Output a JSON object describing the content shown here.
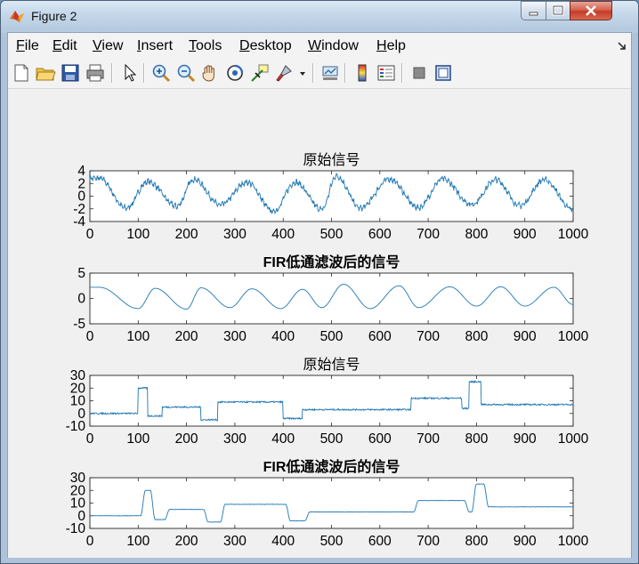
{
  "window": {
    "title": "Figure 2"
  },
  "menu": [
    {
      "pre": "",
      "u": "F",
      "post": "ile"
    },
    {
      "pre": "",
      "u": "E",
      "post": "dit"
    },
    {
      "pre": "",
      "u": "V",
      "post": "iew"
    },
    {
      "pre": "",
      "u": "I",
      "post": "nsert"
    },
    {
      "pre": "",
      "u": "T",
      "post": "ools"
    },
    {
      "pre": "",
      "u": "D",
      "post": "esktop"
    },
    {
      "pre": "",
      "u": "W",
      "post": "indow"
    },
    {
      "pre": "",
      "u": "H",
      "post": "elp"
    }
  ],
  "toolbar": {
    "icons": [
      "new-figure-icon",
      "open-file-icon",
      "save-icon",
      "print-icon",
      "pointer-icon",
      "zoom-in-icon",
      "zoom-out-icon",
      "pan-hand-icon",
      "rotate-3d-icon",
      "data-cursor-icon",
      "brush-icon",
      "brush-dropdown-icon",
      "link-plot-icon",
      "colorbar-icon",
      "legend-icon",
      "hide-plot-tools-icon",
      "show-plot-tools-icon"
    ]
  },
  "colors": {
    "line": "#1f77b4",
    "axes_bg": "#ffffff",
    "figure_bg": "#f0f0f0"
  },
  "chart_data": [
    {
      "type": "line",
      "title": "原始信号",
      "title_bold": false,
      "xlim": [
        0,
        1000
      ],
      "ylim": [
        -4,
        4
      ],
      "xticks": [
        "0",
        "100",
        "200",
        "300",
        "400",
        "500",
        "600",
        "700",
        "800",
        "900",
        "1000"
      ],
      "yticks": [
        "4",
        "2",
        "0",
        "-2",
        "-4"
      ],
      "signal": {
        "kind": "noisy_periodic",
        "period": 55,
        "peaks": [
          [
            20,
            2.8
          ],
          [
            75,
            -1.9
          ],
          [
            120,
            2.3
          ],
          [
            180,
            -1.6
          ],
          [
            215,
            2.7
          ],
          [
            270,
            -1.4
          ],
          [
            325,
            2.2
          ],
          [
            380,
            -2.4
          ],
          [
            425,
            2.2
          ],
          [
            480,
            -2.1
          ],
          [
            510,
            3.2
          ],
          [
            560,
            -1.9
          ],
          [
            620,
            2.7
          ],
          [
            680,
            -1.8
          ],
          [
            730,
            2.7
          ],
          [
            790,
            -1.3
          ],
          [
            840,
            2.6
          ],
          [
            890,
            -1.5
          ],
          [
            940,
            2.6
          ],
          [
            1000,
            -2.2
          ]
        ],
        "noise": 0.35
      }
    },
    {
      "type": "line",
      "title": "FIR低通滤波后的信号",
      "title_bold": true,
      "xlim": [
        0,
        1000
      ],
      "ylim": [
        -5,
        5
      ],
      "xticks": [
        "0",
        "100",
        "200",
        "300",
        "400",
        "500",
        "600",
        "700",
        "800",
        "900",
        "1000"
      ],
      "yticks": [
        "5",
        "0",
        "-5"
      ],
      "signal": {
        "kind": "smooth_periodic",
        "peaks": [
          [
            20,
            2.2
          ],
          [
            100,
            -2.0
          ],
          [
            135,
            2.0
          ],
          [
            200,
            -2.1
          ],
          [
            230,
            2.1
          ],
          [
            290,
            -1.8
          ],
          [
            335,
            1.9
          ],
          [
            395,
            -2.0
          ],
          [
            440,
            1.8
          ],
          [
            480,
            -1.8
          ],
          [
            525,
            2.8
          ],
          [
            580,
            -2.0
          ],
          [
            640,
            2.5
          ],
          [
            680,
            -1.8
          ],
          [
            745,
            2.3
          ],
          [
            800,
            -1.5
          ],
          [
            850,
            2.3
          ],
          [
            900,
            -1.5
          ],
          [
            960,
            2.2
          ],
          [
            1000,
            -1.2
          ]
        ],
        "noise": 0.0
      }
    },
    {
      "type": "line",
      "title": "原始信号",
      "title_bold": false,
      "xlim": [
        0,
        1000
      ],
      "ylim": [
        -10,
        30
      ],
      "xticks": [
        "0",
        "100",
        "200",
        "300",
        "400",
        "500",
        "600",
        "700",
        "800",
        "900",
        "1000"
      ],
      "yticks": [
        "30",
        "20",
        "10",
        "0",
        "-10"
      ],
      "signal": {
        "kind": "step",
        "steps": [
          [
            0,
            0
          ],
          [
            100,
            20
          ],
          [
            120,
            -2
          ],
          [
            150,
            5
          ],
          [
            230,
            -5
          ],
          [
            265,
            9
          ],
          [
            400,
            -4
          ],
          [
            440,
            3
          ],
          [
            665,
            12
          ],
          [
            770,
            4
          ],
          [
            785,
            25
          ],
          [
            810,
            7
          ],
          [
            1000,
            7
          ]
        ],
        "noise": 0.6
      }
    },
    {
      "type": "line",
      "title": "FIR低通滤波后的信号",
      "title_bold": true,
      "xlim": [
        0,
        1000
      ],
      "ylim": [
        -10,
        30
      ],
      "xticks": [
        "0",
        "100",
        "200",
        "300",
        "400",
        "500",
        "600",
        "700",
        "800",
        "900",
        "1000"
      ],
      "yticks": [
        "30",
        "20",
        "10",
        "0",
        "-10"
      ],
      "signal": {
        "kind": "step",
        "steps": [
          [
            0,
            0
          ],
          [
            110,
            20
          ],
          [
            130,
            -3
          ],
          [
            160,
            5
          ],
          [
            240,
            -5
          ],
          [
            275,
            9
          ],
          [
            410,
            -4
          ],
          [
            450,
            3
          ],
          [
            675,
            12
          ],
          [
            780,
            3
          ],
          [
            795,
            25
          ],
          [
            820,
            7
          ],
          [
            1000,
            7
          ]
        ],
        "noise": 0.15,
        "smooth": true
      }
    }
  ]
}
